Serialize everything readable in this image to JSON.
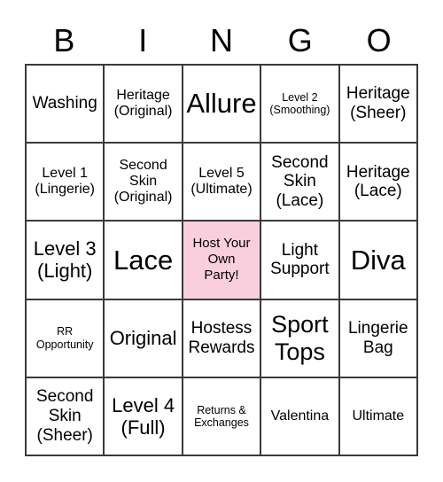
{
  "card": {
    "header_letters": [
      "B",
      "I",
      "N",
      "G",
      "O"
    ],
    "free_space_color": "#F9CEDD",
    "grid_line_color": "#3A3A3A",
    "background_color": "#FFFFFF",
    "rows": [
      [
        {
          "text": "Washing",
          "size": "md",
          "free": false
        },
        {
          "text": "Heritage\n(Original)",
          "size": "sm",
          "free": false
        },
        {
          "text": "Allure",
          "size": "xxl",
          "free": false
        },
        {
          "text": "Level 2\n(Smoothing)",
          "size": "xs",
          "free": false
        },
        {
          "text": "Heritage\n(Sheer)",
          "size": "md",
          "free": false
        }
      ],
      [
        {
          "text": "Level 1\n(Lingerie)",
          "size": "sm",
          "free": false
        },
        {
          "text": "Second\nSkin\n(Original)",
          "size": "sm",
          "free": false
        },
        {
          "text": "Level 5\n(Ultimate)",
          "size": "sm",
          "free": false
        },
        {
          "text": "Second\nSkin\n(Lace)",
          "size": "md",
          "free": false
        },
        {
          "text": "Heritage\n(Lace)",
          "size": "md",
          "free": false
        }
      ],
      [
        {
          "text": "Level 3\n(Light)",
          "size": "lg",
          "free": false
        },
        {
          "text": "Lace",
          "size": "xxl",
          "free": false
        },
        {
          "text": "Host Your\nOwn\nParty!",
          "size": "free",
          "free": true
        },
        {
          "text": "Light\nSupport",
          "size": "md",
          "free": false
        },
        {
          "text": "Diva",
          "size": "xxl",
          "free": false
        }
      ],
      [
        {
          "text": "RR\nOpportunity",
          "size": "xs",
          "free": false
        },
        {
          "text": "Original",
          "size": "lg",
          "free": false
        },
        {
          "text": "Hostess\nRewards",
          "size": "md",
          "free": false
        },
        {
          "text": "Sport\nTops",
          "size": "xl",
          "free": false
        },
        {
          "text": "Lingerie\nBag",
          "size": "md",
          "free": false
        }
      ],
      [
        {
          "text": "Second\nSkin\n(Sheer)",
          "size": "md",
          "free": false
        },
        {
          "text": "Level 4\n(Full)",
          "size": "lg",
          "free": false
        },
        {
          "text": "Returns &\nExchanges",
          "size": "xs",
          "free": false
        },
        {
          "text": "Valentina",
          "size": "sm",
          "free": false
        },
        {
          "text": "Ultimate",
          "size": "sm",
          "free": false
        }
      ]
    ]
  }
}
